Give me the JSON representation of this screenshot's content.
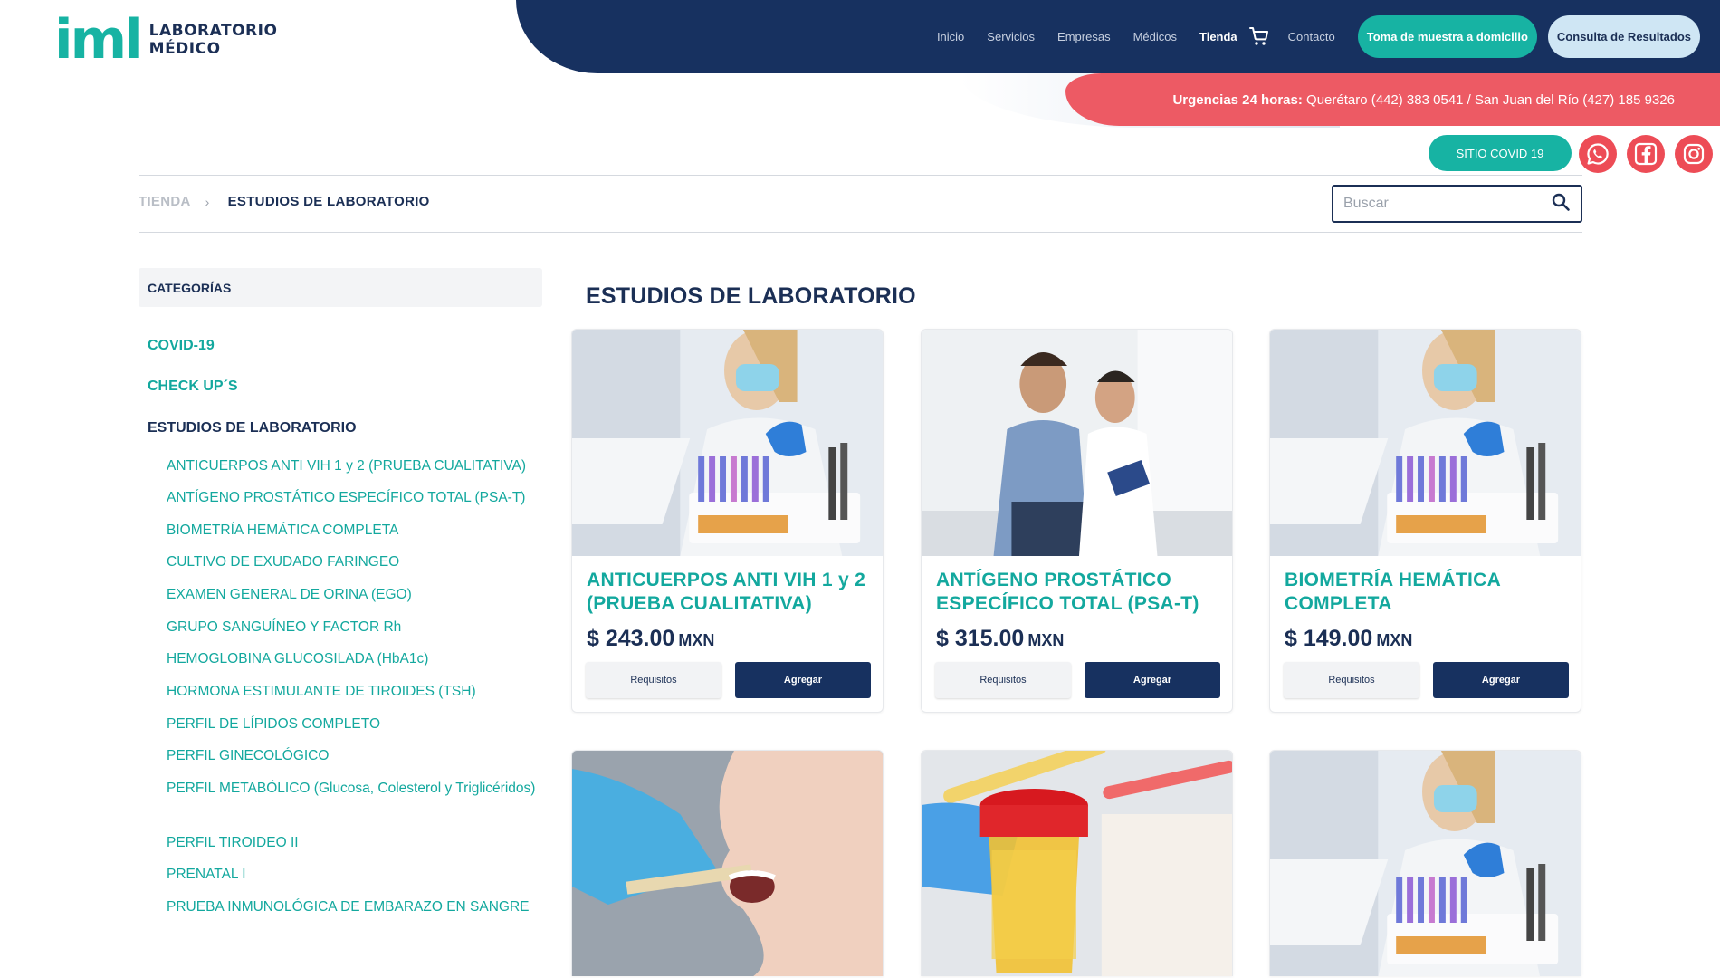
{
  "brand": {
    "mark": "iml",
    "line1": "LABORATORIO",
    "line2": "MÉDICO",
    "colors": {
      "navy": "#173160",
      "teal": "#17b3a3",
      "coral": "#ed5a64"
    }
  },
  "nav": {
    "links": [
      "Inicio",
      "Servicios",
      "Empresas",
      "Médicos",
      "Tienda",
      "Contacto"
    ],
    "active": "Tienda",
    "cart_icon": "cart-icon",
    "cta_home": "Toma de muestra a domicilio",
    "cta_results": "Consulta de Resultados"
  },
  "urgency": {
    "label": "Urgencias 24 horas:",
    "text": "Querétaro (442) 383 0541 / San Juan del Río (427) 185 9326"
  },
  "covid_button": "SITIO COVID 19",
  "social_icons": [
    "whatsapp-icon",
    "facebook-icon",
    "instagram-icon"
  ],
  "breadcrumb": {
    "root": "TIENDA",
    "separator": "›",
    "current": "ESTUDIOS DE LABORATORIO"
  },
  "search": {
    "placeholder": "Buscar",
    "value": ""
  },
  "sidebar": {
    "heading": "CATEGORÍAS",
    "categories": [
      "COVID-19",
      "CHECK UP´S",
      "ESTUDIOS DE LABORATORIO"
    ],
    "subcategories": [
      "ANTICUERPOS ANTI VIH 1 y 2 (PRUEBA CUALITATIVA)",
      "ANTÍGENO PROSTÁTICO ESPECÍFICO TOTAL (PSA-T)",
      "BIOMETRÍA HEMÁTICA COMPLETA",
      "CULTIVO DE EXUDADO FARINGEO",
      "EXAMEN GENERAL DE ORINA (EGO)",
      "GRUPO SANGUÍNEO Y FACTOR Rh",
      "HEMOGLOBINA GLUCOSILADA (HbA1c)",
      "HORMONA ESTIMULANTE DE TIROIDES (TSH)",
      "PERFIL DE LÍPIDOS COMPLETO",
      "PERFIL GINECOLÓGICO",
      "PERFIL METABÓLICO (Glucosa, Colesterol y Triglicéridos)",
      "PERFIL TIROIDEO II",
      "PRENATAL I",
      "PRUEBA INMUNOLÓGICA DE EMBARAZO EN SANGRE"
    ]
  },
  "main": {
    "title": "ESTUDIOS DE LABORATORIO",
    "products": [
      {
        "title": "ANTICUERPOS ANTI VIH 1 y 2 (PRUEBA CUALITATIVA)",
        "price": "$ 243.00",
        "currency": "MXN",
        "image": "lab-technician-photo"
      },
      {
        "title": "ANTÍGENO PROSTÁTICO ESPECÍFICO TOTAL (PSA-T)",
        "price": "$ 315.00",
        "currency": "MXN",
        "image": "doctor-patient-photo"
      },
      {
        "title": "BIOMETRÍA HEMÁTICA COMPLETA",
        "price": "$ 149.00",
        "currency": "MXN",
        "image": "lab-technician-photo"
      }
    ],
    "more_images": [
      "throat-swab-photo",
      "urine-sample-photo",
      "lab-technician-photo"
    ],
    "requirements_label": "Requisitos",
    "add_label": "Agregar"
  }
}
